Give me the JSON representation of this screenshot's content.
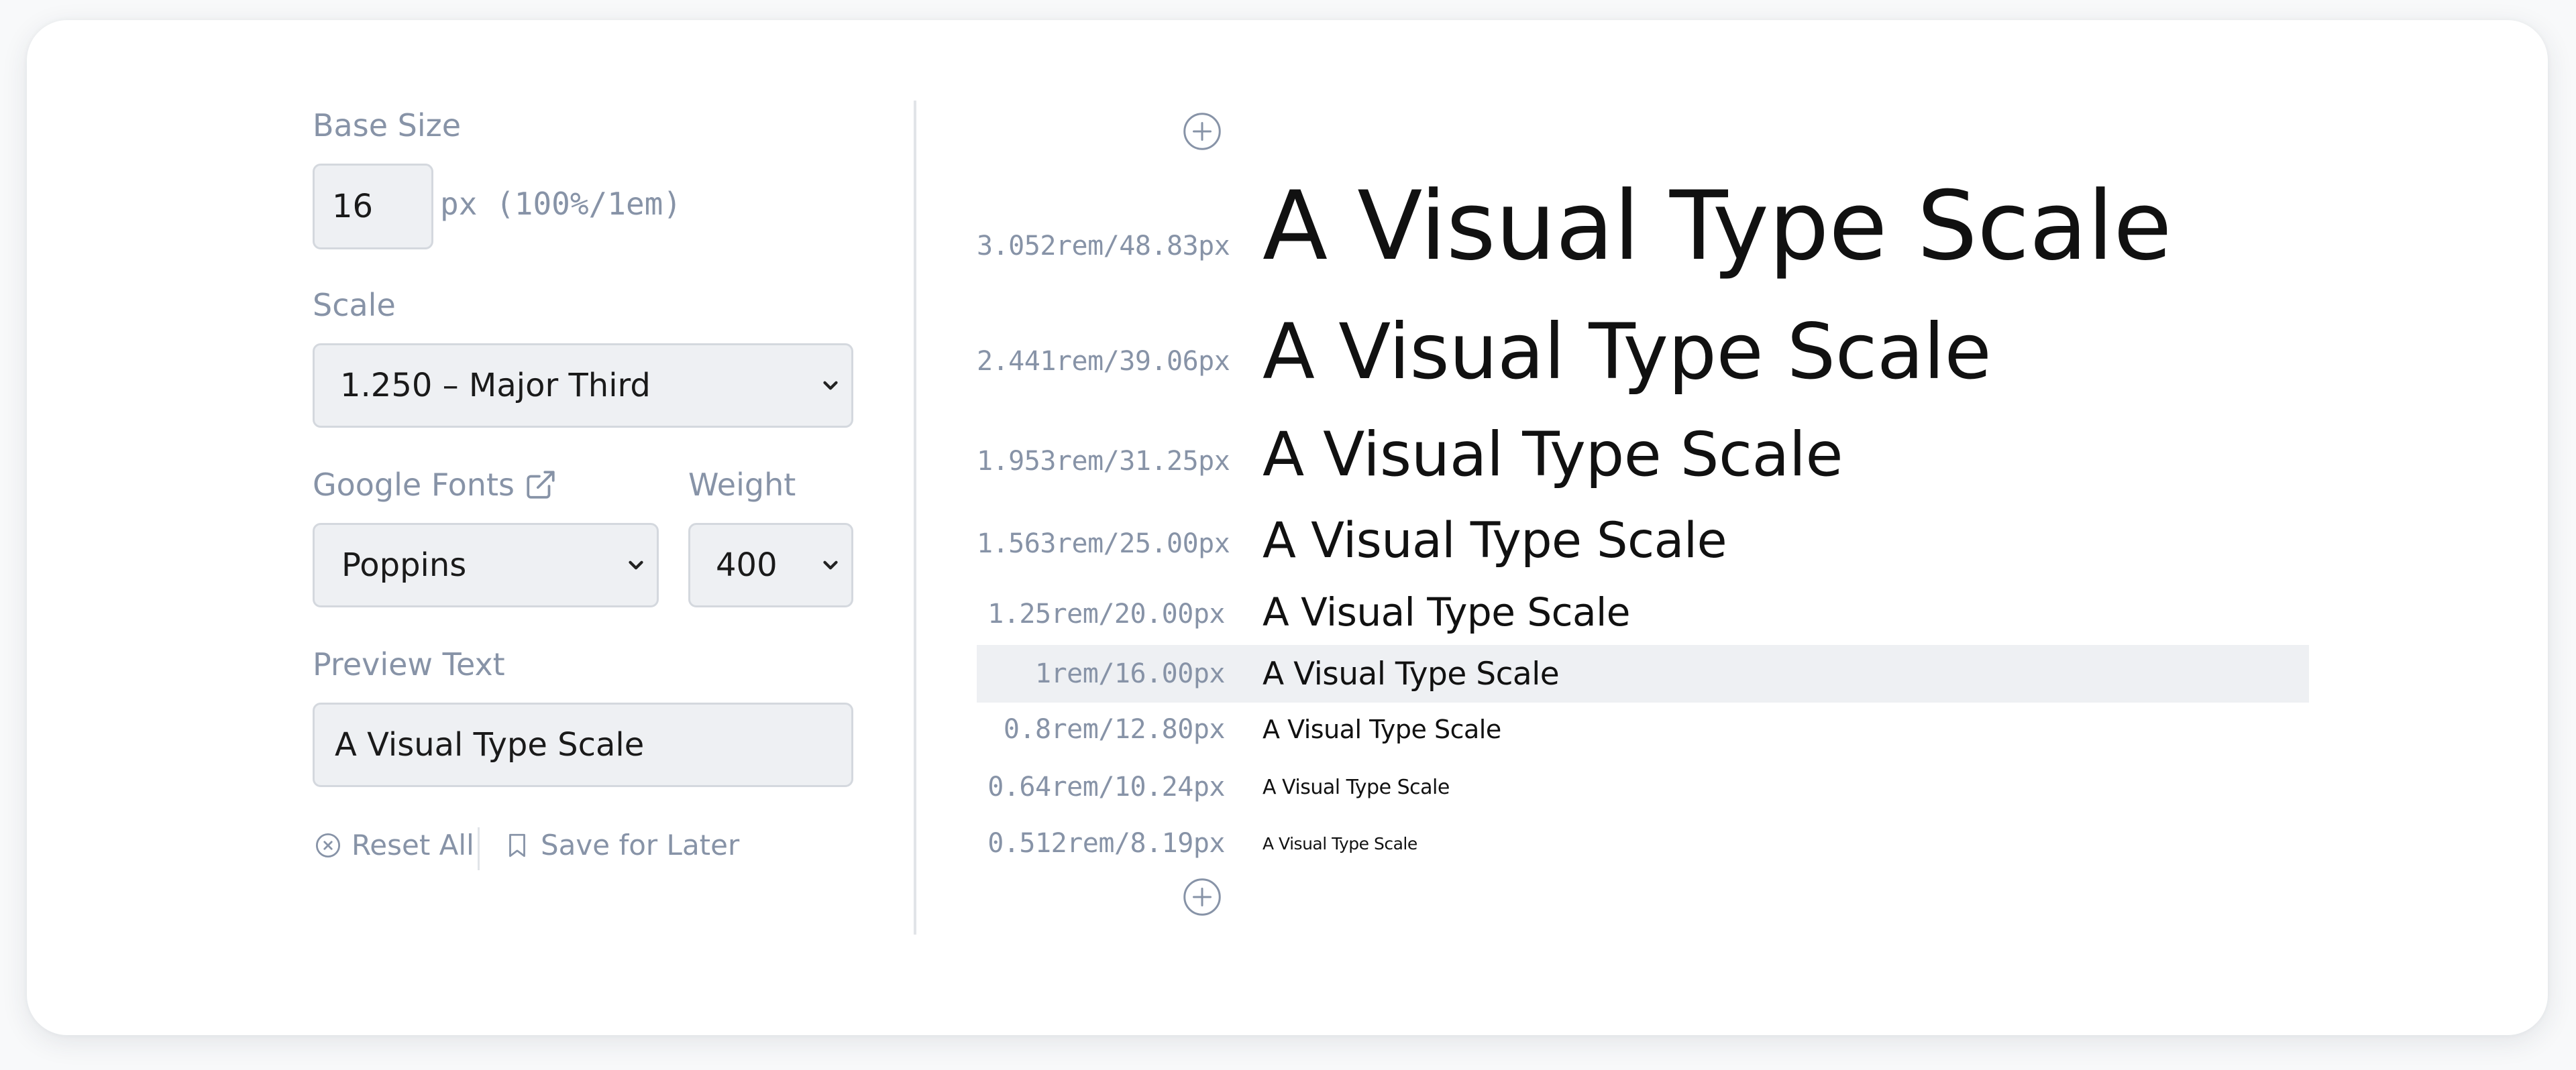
{
  "controls": {
    "base_size_label": "Base Size",
    "base_size_value": "16",
    "base_size_unit": "px (100%/1em)",
    "scale_label": "Scale",
    "scale_value": "1.250 – Major Third",
    "fonts_label": "Google Fonts",
    "font_value": "Poppins",
    "weight_label": "Weight",
    "weight_value": "400",
    "preview_label": "Preview Text",
    "preview_value": "A Visual Type Scale",
    "reset_label": "Reset All",
    "save_label": "Save for Later"
  },
  "scale_rows": [
    {
      "size": "3.052rem/48.83px",
      "text": "A Visual Type Scale"
    },
    {
      "size": "2.441rem/39.06px",
      "text": "A Visual Type Scale"
    },
    {
      "size": "1.953rem/31.25px",
      "text": "A Visual Type Scale"
    },
    {
      "size": "1.563rem/25.00px",
      "text": "A Visual Type Scale"
    },
    {
      "size": "1.25rem/20.00px",
      "text": "A Visual Type Scale"
    },
    {
      "size": "1rem/16.00px",
      "text": "A Visual Type Scale"
    },
    {
      "size": "0.8rem/12.80px",
      "text": "A Visual Type Scale"
    },
    {
      "size": "0.64rem/10.24px",
      "text": "A Visual Type Scale"
    },
    {
      "size": "0.512rem/8.19px",
      "text": "A Visual Type Scale"
    }
  ],
  "icons": {
    "external_link": "external-link-icon",
    "reset": "x-circle-icon",
    "save": "bookmark-icon",
    "add": "plus-circle-icon",
    "select_arrow": "chevron-down-icon"
  },
  "colors": {
    "muted_text": "#8793a7",
    "field_bg": "#eef0f3",
    "highlight_row": "#eef0f3"
  }
}
